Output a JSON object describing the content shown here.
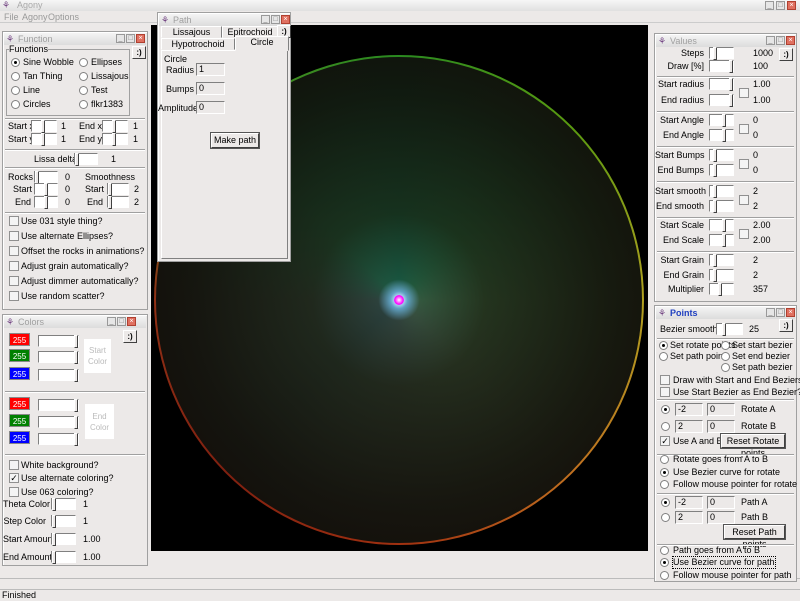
{
  "app": {
    "title": "Agony",
    "menu": [
      "File",
      "Agony",
      "Options"
    ],
    "status": "Finished"
  },
  "function": {
    "title": "Function",
    "smiley": ":)",
    "group": "Functions",
    "radios": [
      {
        "label": "Sine Wobble",
        "checked": true
      },
      {
        "label": "Tan Thing"
      },
      {
        "label": "Line"
      },
      {
        "label": "Circles"
      },
      {
        "label": "Ellipses"
      },
      {
        "label": "Lissajous"
      },
      {
        "label": "Test"
      },
      {
        "label": "flkr1383"
      }
    ],
    "start_x": "Start x",
    "start_x_val": "1",
    "end_x": "End x",
    "end_x_val": "1",
    "start_y": "Start y",
    "start_y_val": "1",
    "end_y": "End y",
    "end_y_val": "1",
    "lissa": "Lissa delta",
    "lissa_val": "1",
    "rocks": "Rocks",
    "rocks_val": "0",
    "smoothness": "Smoothness",
    "start": "Start",
    "end": "End",
    "rocks_start": "0",
    "rocks_end": "0",
    "smooth_start": "2",
    "smooth_end": "2",
    "checks": [
      "Use 031 style thing?",
      "Use alternate Ellipses?",
      "Offset the rocks in animations?",
      "Adjust grain automatically?",
      "Adjust dimmer automatically?",
      "Use random scatter?"
    ]
  },
  "path": {
    "title": "Path",
    "tabs": [
      "Lissajous",
      "Epitrochoid",
      "Hypotrochoid",
      "Circle"
    ],
    "active_tab": "Circle",
    "smiley": ":)",
    "section": "Circle",
    "radius_label": "Radius",
    "radius": "1",
    "bumps_label": "Bumps",
    "bumps": "0",
    "amplitude_label": "Amplitude",
    "amplitude": "0",
    "make": "Make path"
  },
  "colors": {
    "title": "Colors",
    "smiley": ":)",
    "start": [
      "255",
      "255",
      "255"
    ],
    "end": [
      "255",
      "255",
      "255"
    ],
    "swatches": [
      "#ff0000",
      "#008000",
      "#0000ff"
    ],
    "start_label": "Start Color",
    "end_label": "End Color",
    "checks": [
      {
        "label": "White background?",
        "checked": false
      },
      {
        "label": "Use alternate coloring?",
        "checked": true
      },
      {
        "label": "Use 063 coloring?",
        "checked": false
      }
    ],
    "theta": "Theta Color",
    "theta_val": "1",
    "step": "Step Color",
    "step_val": "1",
    "start_amount": "Start Amount",
    "start_amount_val": "1.00",
    "end_amount": "End Amount",
    "end_amount_val": "1.00"
  },
  "values": {
    "title": "Values",
    "smiley": ":)",
    "rows": [
      {
        "label": "Steps",
        "value": "1000"
      },
      {
        "label": "Draw [%]",
        "value": "100"
      },
      {
        "label": "Start radius",
        "value": "1.00"
      },
      {
        "label": "End radius",
        "value": "1.00"
      },
      {
        "label": "Start Angle",
        "value": "0"
      },
      {
        "label": "End Angle",
        "value": "0"
      },
      {
        "label": "Start Bumps",
        "value": "0"
      },
      {
        "label": "End Bumps",
        "value": "0"
      },
      {
        "label": "Start smooth",
        "value": "2"
      },
      {
        "label": "End smooth",
        "value": "2"
      },
      {
        "label": "Start Scale",
        "value": "2.00"
      },
      {
        "label": "End Scale",
        "value": "2.00"
      },
      {
        "label": "Start Grain",
        "value": "2"
      },
      {
        "label": "End Grain",
        "value": "2"
      },
      {
        "label": "Multiplier",
        "value": "357"
      }
    ]
  },
  "points": {
    "title": "Points",
    "smiley": ":)",
    "bezier": "Bezier smoothing",
    "bezier_val": "25",
    "set_rotate": "Set rotate points",
    "set_path": "Set path points",
    "set_start_bezier": "Set start bezier",
    "set_end_bezier": "Set end bezier",
    "set_path_bezier": "Set path bezier",
    "draw_se": "Draw with Start and End Beziers?",
    "use_start": "Use Start Bezier as End Bezier?",
    "rot_a": [
      "-2",
      "0"
    ],
    "rot_a_label": "Rotate A",
    "rot_b": [
      "2",
      "0"
    ],
    "rot_b_label": "Rotate B",
    "use_ab": "Use A and B?",
    "reset_rot": "Reset Rotate points",
    "rot_modes": [
      "Rotate goes from A to B",
      "Use Bezier curve for rotate",
      "Follow mouse pointer for rotate"
    ],
    "path_a": [
      "-2",
      "0"
    ],
    "path_a_label": "Path A",
    "path_b": [
      "2",
      "0"
    ],
    "path_b_label": "Path B",
    "reset_path": "Reset Path points",
    "path_modes": [
      "Path goes from A to B",
      "Use Bezier curve for path",
      "Follow mouse pointer for path"
    ]
  }
}
